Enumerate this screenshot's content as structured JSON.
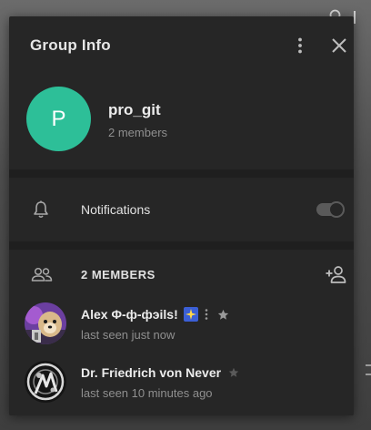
{
  "dialog": {
    "title": "Group Info"
  },
  "group": {
    "avatar_letter": "P",
    "avatar_color": "#2dbf98",
    "name": "pro_git",
    "members_text": "2 members"
  },
  "notifications": {
    "label": "Notifications",
    "enabled": false
  },
  "members": {
    "header": "2 MEMBERS",
    "list": [
      {
        "name": "Alex Φ-ф-фэils!",
        "status": "last seen just now",
        "badges": [
          "sparkle-emoji",
          "more-dots",
          "star"
        ]
      },
      {
        "name": "Dr. Friedrich von Never",
        "status": "last seen 10 minutes ago",
        "badges": [
          "star"
        ]
      }
    ]
  },
  "icons": {
    "menu": "more-vertical-icon",
    "close": "close-icon",
    "bell": "bell-icon",
    "members": "people-icon",
    "add_member": "add-person-icon"
  }
}
